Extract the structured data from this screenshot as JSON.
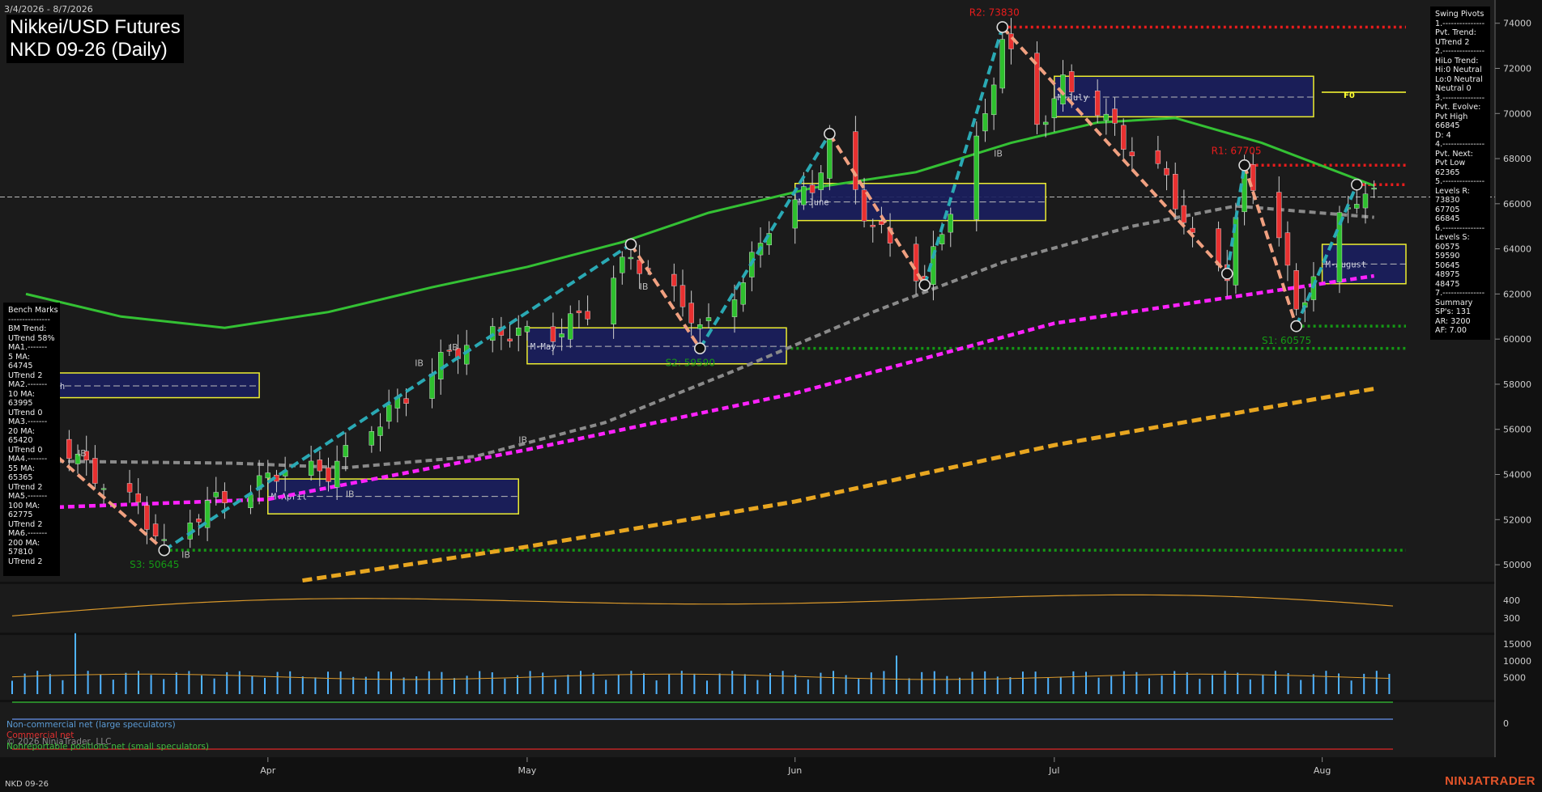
{
  "header": {
    "date_range": "3/4/2026 - 8/7/2026",
    "title_line1": "Nikkei/USD Futures",
    "title_line2": "NKD 09-26 (Daily)"
  },
  "swing_panel": {
    "lines": [
      "Swing Pivots",
      "1.---------------",
      "Pvt. Trend:",
      "UTrend 2",
      "2.---------------",
      "HiLo Trend:",
      "Hi:0 Neutral",
      "Lo:0 Neutral",
      "Neutral 0",
      "3.---------------",
      "Pvt. Evolve:",
      "Pvt High",
      "66845",
      "D: 4",
      "4.---------------",
      "Pvt. Next:",
      "Pvt Low",
      "62365",
      "5.---------------",
      "Levels R:",
      "73830",
      "67705",
      "66845",
      "6.---------------",
      "Levels S:",
      "60575",
      "59590",
      "50645",
      "48975",
      "48475",
      "7.---------------",
      "Summary",
      "SP's: 131",
      "AR: 3200",
      "AF: 7.00"
    ]
  },
  "bench_panel": {
    "lines": [
      "Bench Marks",
      "---------------",
      "BM Trend:",
      "UTrend 58%",
      "MA1.-------",
      "5 MA:",
      "64745",
      "UTrend 2",
      "MA2.-------",
      "10 MA:",
      "63995",
      "UTrend 0",
      "MA3.-------",
      "20 MA:",
      "65420",
      "UTrend 0",
      "MA4.-------",
      "55 MA:",
      "65365",
      "UTrend 2",
      "MA5.-------",
      "100 MA:",
      "62775",
      "UTrend 2",
      "MA6.-------",
      "200 MA:",
      "57810",
      "UTrend 2"
    ]
  },
  "footer": {
    "symbol": "NKD 09-26",
    "brand": "NINJATRADER",
    "cot_noncommercial": "Non-commercial net (large speculators)",
    "cot_commercial": "Commercial net",
    "cot_copyright": "© 2026 NinjaTrader, LLC",
    "cot_nonreportable": "Nonreportable positions net (small speculators)"
  },
  "colors": {
    "bg": "#1b1b1b",
    "up": "#2ec02e",
    "down": "#e83030",
    "ma20": "#34c134",
    "ma55": "#8a8a8a",
    "ma100": "#ff22ff",
    "ma200": "#e8a620",
    "swing_up": "#2aa9b4",
    "swing_down": "#f0a080",
    "resist": "#e81c1c",
    "support": "#159915",
    "range_box": "#1a1f5e",
    "range_edge": "#ffff33",
    "vol": "#4fb3ff"
  },
  "chart_data": {
    "type": "candlestick",
    "ylim": [
      49500,
      74600
    ],
    "y_ticks": [
      50000,
      52000,
      54000,
      56000,
      58000,
      60000,
      62000,
      64000,
      66000,
      68000,
      70000,
      72000,
      74000
    ],
    "x_labels": [
      {
        "label": "Apr",
        "date": "2026-04-01"
      },
      {
        "label": "May",
        "date": "2026-05-01"
      },
      {
        "label": "Jun",
        "date": "2026-06-01"
      },
      {
        "label": "Jul",
        "date": "2026-07-01"
      },
      {
        "label": "Aug",
        "date": "2026-08-01"
      }
    ],
    "last_price": 66300,
    "price_anchors": [
      [
        "2026-03-04",
        55700
      ],
      [
        "2026-03-09",
        55100
      ],
      [
        "2026-03-12",
        53900
      ],
      [
        "2026-03-17",
        52600
      ],
      [
        "2026-03-20",
        50700
      ],
      [
        "2026-03-25",
        52700
      ],
      [
        "2026-03-30",
        53400
      ],
      [
        "2026-04-03",
        54300
      ],
      [
        "2026-04-08",
        54100
      ],
      [
        "2026-04-13",
        56100
      ],
      [
        "2026-04-17",
        57500
      ],
      [
        "2026-04-22",
        59400
      ],
      [
        "2026-04-28",
        60300
      ],
      [
        "2026-05-04",
        60200
      ],
      [
        "2026-05-08",
        61300
      ],
      [
        "2026-05-13",
        63700
      ],
      [
        "2026-05-15",
        62900
      ],
      [
        "2026-05-19",
        61700
      ],
      [
        "2026-05-21",
        60300
      ],
      [
        "2026-05-26",
        62600
      ],
      [
        "2026-05-29",
        65100
      ],
      [
        "2026-06-03",
        66700
      ],
      [
        "2026-06-05",
        68700
      ],
      [
        "2026-06-09",
        65600
      ],
      [
        "2026-06-12",
        64200
      ],
      [
        "2026-06-16",
        62600
      ],
      [
        "2026-06-19",
        65900
      ],
      [
        "2026-06-23",
        69700
      ],
      [
        "2026-06-25",
        73500
      ],
      [
        "2026-06-29",
        69400
      ],
      [
        "2026-07-02",
        71300
      ],
      [
        "2026-07-06",
        70300
      ],
      [
        "2026-07-09",
        68700
      ],
      [
        "2026-07-14",
        67100
      ],
      [
        "2026-07-17",
        64300
      ],
      [
        "2026-07-21",
        63000
      ],
      [
        "2026-07-23",
        67500
      ],
      [
        "2026-07-27",
        64800
      ],
      [
        "2026-07-29",
        61100
      ],
      [
        "2026-07-31",
        62900
      ],
      [
        "2026-08-03",
        65200
      ],
      [
        "2026-08-05",
        66400
      ],
      [
        "2026-08-07",
        66300
      ]
    ],
    "moving_averages": [
      {
        "name": "20 MA",
        "style": "solid",
        "points": [
          [
            "2026-03-04",
            62000
          ],
          [
            "2026-03-15",
            61000
          ],
          [
            "2026-03-27",
            60500
          ],
          [
            "2026-04-08",
            61200
          ],
          [
            "2026-04-20",
            62300
          ],
          [
            "2026-05-01",
            63200
          ],
          [
            "2026-05-12",
            64300
          ],
          [
            "2026-05-22",
            65600
          ],
          [
            "2026-06-03",
            66700
          ],
          [
            "2026-06-15",
            67400
          ],
          [
            "2026-06-26",
            68700
          ],
          [
            "2026-07-06",
            69600
          ],
          [
            "2026-07-15",
            69800
          ],
          [
            "2026-07-25",
            68700
          ],
          [
            "2026-08-07",
            66800
          ]
        ]
      },
      {
        "name": "55 MA",
        "style": "dashed",
        "points": [
          [
            "2026-03-04",
            54600
          ],
          [
            "2026-03-28",
            54500
          ],
          [
            "2026-04-10",
            54300
          ],
          [
            "2026-04-25",
            54800
          ],
          [
            "2026-05-10",
            56300
          ],
          [
            "2026-05-25",
            58600
          ],
          [
            "2026-06-10",
            61200
          ],
          [
            "2026-06-25",
            63400
          ],
          [
            "2026-07-10",
            65000
          ],
          [
            "2026-07-22",
            65900
          ],
          [
            "2026-08-07",
            65400
          ]
        ]
      },
      {
        "name": "100 MA",
        "style": "dashed",
        "points": [
          [
            "2026-03-04",
            52500
          ],
          [
            "2026-04-01",
            52900
          ],
          [
            "2026-05-01",
            55100
          ],
          [
            "2026-06-01",
            57600
          ],
          [
            "2026-07-01",
            60700
          ],
          [
            "2026-08-07",
            62800
          ]
        ]
      },
      {
        "name": "200 MA",
        "style": "dashed",
        "points": [
          [
            "2026-04-05",
            49300
          ],
          [
            "2026-05-01",
            50800
          ],
          [
            "2026-06-01",
            52800
          ],
          [
            "2026-07-01",
            55300
          ],
          [
            "2026-08-07",
            57800
          ]
        ]
      }
    ],
    "swing_lines": [
      [
        "2026-03-04",
        56000,
        "2026-03-20",
        50645
      ],
      [
        "2026-03-20",
        50645,
        "2026-05-13",
        64200
      ],
      [
        "2026-05-13",
        64200,
        "2026-05-21",
        59590
      ],
      [
        "2026-05-21",
        59590,
        "2026-06-05",
        69100
      ],
      [
        "2026-06-05",
        69100,
        "2026-06-16",
        62400
      ],
      [
        "2026-06-16",
        62400,
        "2026-06-25",
        73830
      ],
      [
        "2026-06-25",
        73830,
        "2026-07-21",
        62900
      ],
      [
        "2026-07-21",
        62900,
        "2026-07-23",
        67705
      ],
      [
        "2026-07-23",
        67705,
        "2026-07-29",
        60575
      ],
      [
        "2026-07-29",
        60575,
        "2026-08-05",
        66845
      ]
    ],
    "pivots": [
      {
        "date": "2026-06-25",
        "price": 73830,
        "label": "R2: 73830"
      },
      {
        "date": "2026-07-23",
        "price": 67705,
        "label": "R1: 67705"
      },
      {
        "date": "2026-05-21",
        "price": 59590,
        "label": "S2: 59590"
      },
      {
        "date": "2026-07-29",
        "price": 60575,
        "label": "S1: 60575"
      },
      {
        "date": "2026-03-20",
        "price": 50645,
        "label": "S3: 50645"
      }
    ],
    "levels": [
      {
        "price": 73830,
        "from": "2026-06-25",
        "color": "resist"
      },
      {
        "price": 67705,
        "from": "2026-07-23",
        "color": "resist"
      },
      {
        "price": 66845,
        "from": "2026-08-05",
        "color": "resist"
      },
      {
        "price": 60575,
        "from": "2026-07-29",
        "color": "support"
      },
      {
        "price": 59590,
        "from": "2026-05-21",
        "color": "support"
      },
      {
        "price": 50645,
        "from": "2026-03-20",
        "color": "support"
      }
    ],
    "range_boxes": [
      {
        "label": "M-March",
        "from": "2026-03-04",
        "to": "2026-03-31",
        "high": 58500,
        "low": 58050,
        "mid": 58250
      },
      {
        "label": "M-April",
        "from": "2026-04-01",
        "to": "2026-04-30",
        "high": 53800,
        "low": 52900,
        "mid": 53350
      },
      {
        "label": "M-May",
        "from": "2026-05-01",
        "to": "2026-05-31",
        "high": 60500,
        "low": 59550,
        "mid": 60000
      },
      {
        "label": "M-June",
        "from": "2026-06-01",
        "to": "2026-06-30",
        "high": 66900,
        "low": 65900,
        "mid": 66400
      },
      {
        "label": "M-July",
        "from": "2026-07-01",
        "to": "2026-07-31",
        "high": 71650,
        "low": 70500,
        "mid": 71050
      },
      {
        "label": "M-August",
        "from": "2026-08-01",
        "to": "2026-08-07",
        "high": 64200,
        "low": 63100,
        "mid": 63650
      }
    ],
    "month_labels_at": "low"
  },
  "indicators": {
    "atr": {
      "ticks": [
        300,
        400
      ]
    },
    "volume": {
      "ticks": [
        5000,
        10000,
        15000
      ]
    },
    "cot": {
      "ticks": [
        0
      ]
    }
  },
  "f0_label": "F0",
  "ib_label": "IB"
}
